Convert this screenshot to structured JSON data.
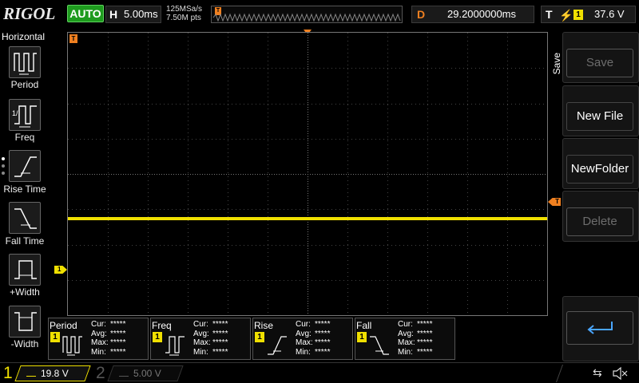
{
  "top_bar": {
    "logo": "RIGOL",
    "run_status": "AUTO",
    "horizontal": {
      "key": "H",
      "value": "5.00ms"
    },
    "sample_rate": "125MSa/s",
    "memory_depth": "7.50M pts",
    "delay": {
      "key": "D",
      "value": "29.2000000ms"
    },
    "trigger": {
      "key": "T",
      "channel": "1",
      "level": "37.6 V"
    }
  },
  "left_menu": {
    "title": "Horizontal",
    "items": [
      {
        "label": "Period"
      },
      {
        "label": "Freq"
      },
      {
        "label": "Rise Time"
      },
      {
        "label": "Fall Time"
      },
      {
        "label": "+Width"
      },
      {
        "label": "-Width"
      }
    ]
  },
  "grid_markers": {
    "trigger_time": "T",
    "trigger_level": "T",
    "channel": "1"
  },
  "right_menu": {
    "title": "Save",
    "items": [
      {
        "label": "Save",
        "enabled": false
      },
      {
        "label": "New File",
        "enabled": true
      },
      {
        "label": "NewFolder",
        "enabled": true
      },
      {
        "label": "Delete",
        "enabled": false
      }
    ]
  },
  "measurements": [
    {
      "name": "Period",
      "channel": "1",
      "cur": "*****",
      "avg": "*****",
      "max": "*****",
      "min": "*****"
    },
    {
      "name": "Freq",
      "channel": "1",
      "cur": "*****",
      "avg": "*****",
      "max": "*****",
      "min": "*****"
    },
    {
      "name": "Rise",
      "channel": "1",
      "cur": "*****",
      "avg": "*****",
      "max": "*****",
      "min": "*****"
    },
    {
      "name": "Fall",
      "channel": "1",
      "cur": "*****",
      "avg": "*****",
      "max": "*****",
      "min": "*****"
    }
  ],
  "stat_labels": {
    "cur": "Cur:",
    "avg": "Avg:",
    "max": "Max:",
    "min": "Min:"
  },
  "channels": [
    {
      "number": "1",
      "scale": "19.8 V",
      "color": "#f0e000",
      "active": true
    },
    {
      "number": "2",
      "scale": "5.00 V",
      "color": "#555555",
      "active": false
    }
  ],
  "colors": {
    "trace": "#f0e000",
    "trigger": "#f08020",
    "auto": "#1e9b1e"
  }
}
